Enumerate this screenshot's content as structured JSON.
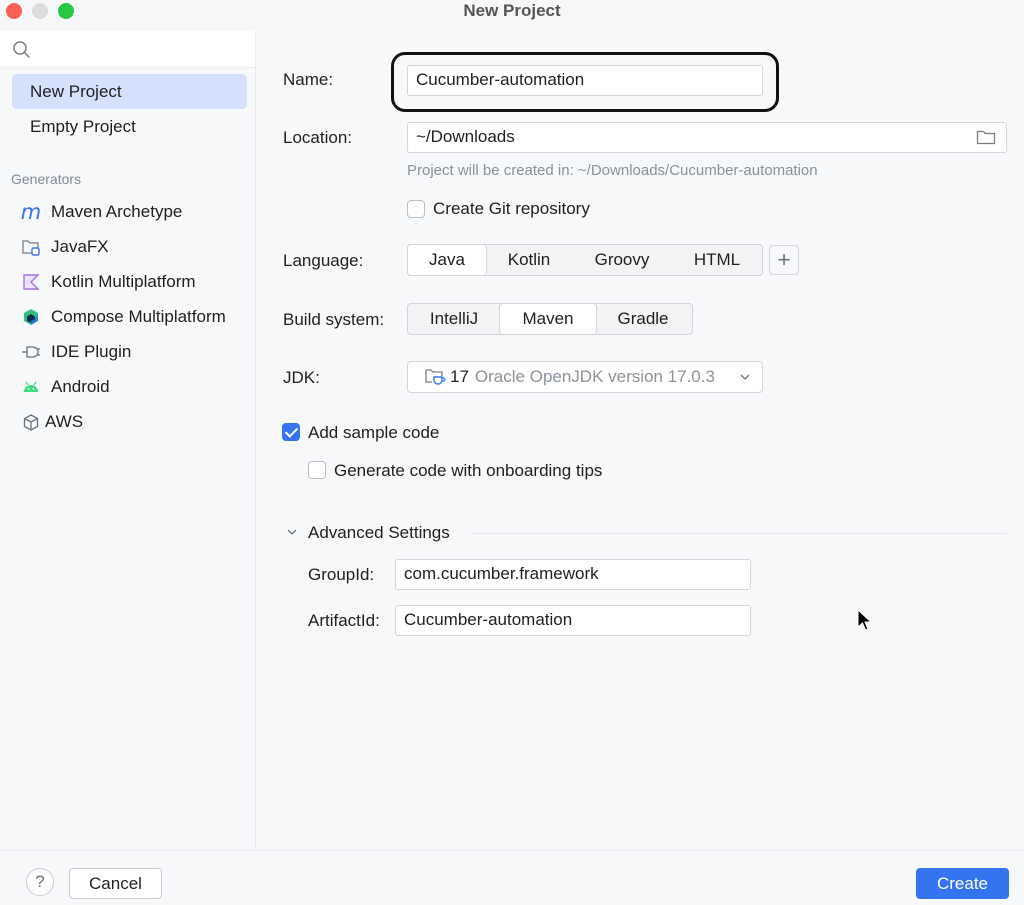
{
  "window": {
    "title": "New Project"
  },
  "sidebar": {
    "search": {
      "placeholder": "",
      "value": ""
    },
    "items": [
      {
        "label": "New Project",
        "selected": true
      },
      {
        "label": "Empty Project",
        "selected": false
      }
    ],
    "generators_label": "Generators",
    "generators": [
      {
        "label": "Maven Archetype",
        "icon": "maven-icon"
      },
      {
        "label": "JavaFX",
        "icon": "javafx-folder-icon"
      },
      {
        "label": "Kotlin Multiplatform",
        "icon": "kotlin-icon"
      },
      {
        "label": "Compose Multiplatform",
        "icon": "compose-icon"
      },
      {
        "label": "IDE Plugin",
        "icon": "plugin-icon"
      },
      {
        "label": "Android",
        "icon": "android-icon"
      },
      {
        "label": "AWS",
        "icon": "aws-cube-icon"
      }
    ]
  },
  "form": {
    "name": {
      "label": "Name:",
      "value": "Cucumber-automation"
    },
    "location": {
      "label": "Location:",
      "value": "~/Downloads",
      "hint": "Project will be created in: ~/Downloads/Cucumber-automation"
    },
    "git": {
      "label": "Create Git repository",
      "checked": false
    },
    "language": {
      "label": "Language:",
      "options": [
        "Java",
        "Kotlin",
        "Groovy",
        "HTML"
      ],
      "selected": "Java",
      "add_label": "+"
    },
    "build_system": {
      "label": "Build system:",
      "options": [
        "IntelliJ",
        "Maven",
        "Gradle"
      ],
      "selected": "Maven"
    },
    "jdk": {
      "label": "JDK:",
      "version": "17",
      "description": "Oracle OpenJDK version 17.0.3"
    },
    "sample_code": {
      "label": "Add sample code",
      "checked": true
    },
    "onboarding_tips": {
      "label": "Generate code with onboarding tips",
      "checked": false
    },
    "advanced": {
      "label": "Advanced Settings",
      "expanded": true,
      "group_id": {
        "label": "GroupId:",
        "value": "com.cucumber.framework"
      },
      "artifact_id": {
        "label": "ArtifactId:",
        "value": "Cucumber-automation"
      }
    }
  },
  "footer": {
    "help_label": "?",
    "cancel_label": "Cancel",
    "create_label": "Create"
  },
  "colors": {
    "accent": "#3574f0",
    "selection": "#d5e1fc"
  }
}
